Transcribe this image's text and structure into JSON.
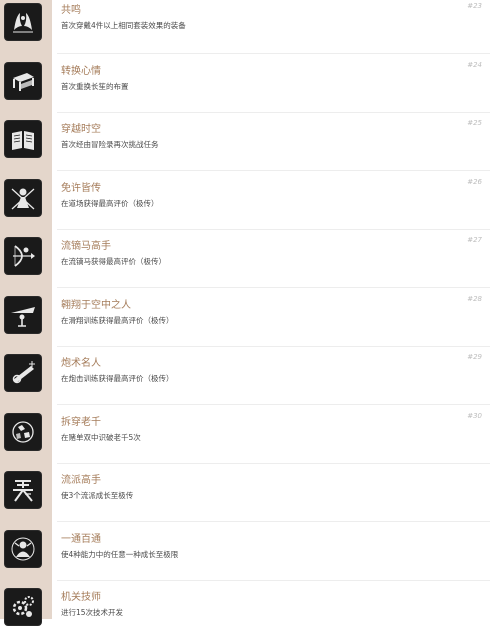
{
  "achievements": [
    {
      "title": "共鸣",
      "desc": "首次穿戴4件以上相同套装效果的装备",
      "num": "#23",
      "icon": "twin-spirits-icon"
    },
    {
      "title": "转换心情",
      "desc": "首次重换长笙的布置",
      "num": "#24",
      "icon": "table-furniture-icon"
    },
    {
      "title": "穿越时空",
      "desc": "首次经由冒险录再次挑战任务",
      "num": "#25",
      "icon": "open-book-icon"
    },
    {
      "title": "免许皆传",
      "desc": "在道场获得最高评价（极传）",
      "num": "#26",
      "icon": "crossed-swords-icon"
    },
    {
      "title": "流镝马高手",
      "desc": "在流镝马获得最高评价（极传）",
      "num": "#27",
      "icon": "archer-horseman-icon"
    },
    {
      "title": "翱翔于空中之人",
      "desc": "在滑翔训练获得最高评价（极传）",
      "num": "#28",
      "icon": "glider-icon"
    },
    {
      "title": "炮术名人",
      "desc": "在炮击训练获得最高评价（极传）",
      "num": "#29",
      "icon": "cannon-icon"
    },
    {
      "title": "拆穿老千",
      "desc": "在赌单双中识破老千5次",
      "num": "#30",
      "icon": "dice-cup-icon"
    },
    {
      "title": "流派高手",
      "desc": "使3个流派成长至极传",
      "num": "",
      "icon": "style-kanji-icon"
    },
    {
      "title": "一通百通",
      "desc": "使4种能力中的任意一种成长至极限",
      "num": "",
      "icon": "warrior-crest-icon"
    },
    {
      "title": "机关技师",
      "desc": "进行15次技术开发",
      "num": "",
      "icon": "gear-mechanism-icon"
    }
  ]
}
